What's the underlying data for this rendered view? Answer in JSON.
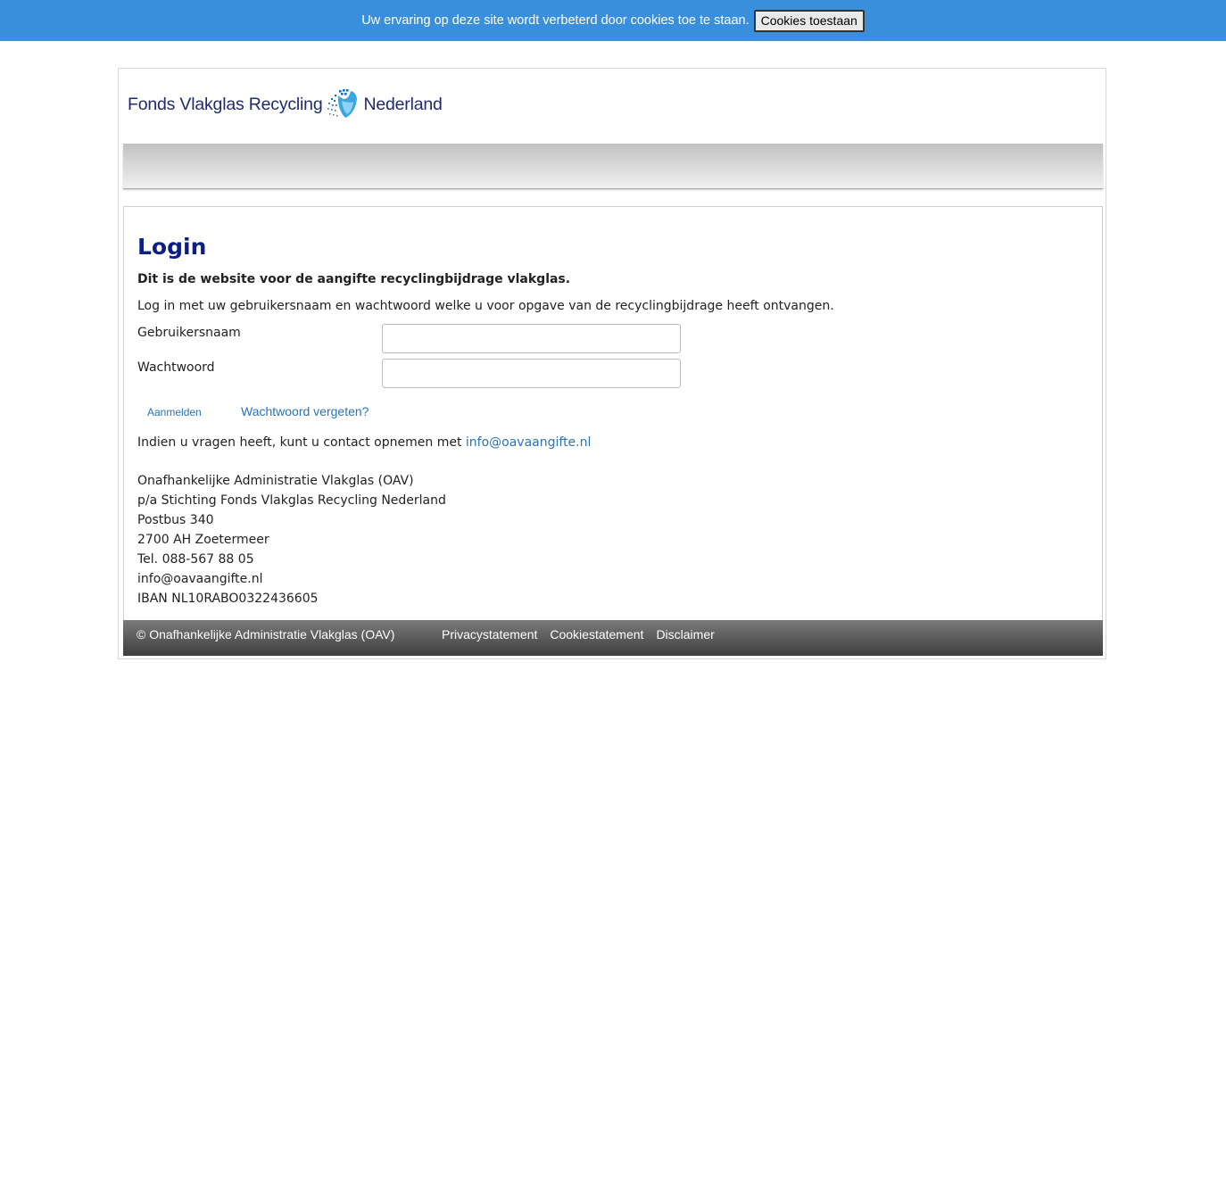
{
  "cookie_bar": {
    "message": "Uw ervaring op deze site wordt verbeterd door cookies toe te staan.",
    "accept_label": "Cookies toestaan",
    "background_color": "#3a8fdc"
  },
  "header": {
    "logo_text_left": "Fonds Vlakglas Recycling",
    "logo_text_right": "Nederland",
    "logo_icon": "recycling-dots-icon",
    "brand_color": "#1e2b6e"
  },
  "main": {
    "title": "Login",
    "intro_bold": "Dit is de website voor de aangifte recyclingbijdrage vlakglas.",
    "instruction": "Log in met uw gebruikersnaam en wachtwoord welke u voor opgave van de recyclingbijdrage heeft ontvangen.",
    "form": {
      "username_label": "Gebruikersnaam",
      "username_value": "",
      "password_label": "Wachtwoord",
      "password_value": "",
      "submit_label": "Aanmelden",
      "forgot_label": "Wachtwoord vergeten?"
    },
    "contact_text": "Indien u vragen heeft, kunt u contact opnemen met",
    "contact_email": "info@oavaangifte.nl",
    "address": [
      "Onafhankelijke Administratie Vlakglas (OAV)",
      "p/a Stichting Fonds Vlakglas Recycling Nederland",
      "Postbus 340",
      "2700 AH Zoetermeer",
      "Tel. 088-567 88 05",
      "info@oavaangifte.nl",
      "IBAN NL10RABO0322436605"
    ],
    "title_color": "#0d1f84",
    "link_color": "#2a73b8"
  },
  "footer": {
    "copyright": "© Onafhankelijke Administratie Vlakglas (OAV)",
    "links": [
      "Privacystatement",
      "Cookiestatement",
      "Disclaimer"
    ]
  }
}
